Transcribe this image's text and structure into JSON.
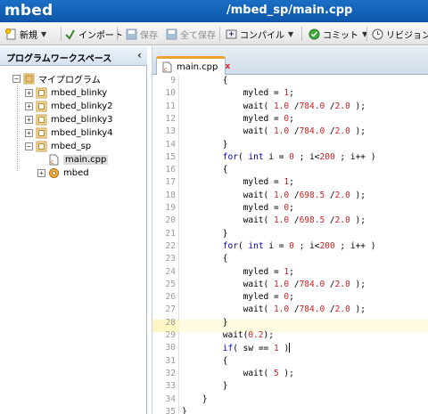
{
  "app": {
    "brand": "mbed",
    "doc_title": "/mbed_sp/main.cpp"
  },
  "toolbar": {
    "new": "新規",
    "import": "インポート",
    "save": "保存",
    "save_all": "全て保存",
    "compile": "コンパイル",
    "commit": "コミット",
    "revision": "リビジョン"
  },
  "sidebar": {
    "title": "プログラムワークスペース",
    "root": "マイプログラム",
    "items": [
      {
        "label": "mbed_blinky"
      },
      {
        "label": "mbed_blinky2"
      },
      {
        "label": "mbed_blinky3"
      },
      {
        "label": "mbed_blinky4"
      },
      {
        "label": "mbed_sp"
      },
      {
        "label": "main.cpp"
      },
      {
        "label": "mbed"
      }
    ]
  },
  "editor": {
    "tab_label": "main.cpp",
    "tab_close": "x",
    "current_line": 30,
    "lines": [
      {
        "n": "9",
        "code": "        {"
      },
      {
        "n": "10",
        "code": "            myled = 1;"
      },
      {
        "n": "11",
        "code": "            wait( 1.0 /784.0 /2.0 );"
      },
      {
        "n": "12",
        "code": "            myled = 0;"
      },
      {
        "n": "13",
        "code": "            wait( 1.0 /784.0 /2.0 );"
      },
      {
        "n": "14",
        "code": "        }"
      },
      {
        "n": "15",
        "code": "        for( int i = 0 ; i<200 ; i++ )"
      },
      {
        "n": "16",
        "code": "        {"
      },
      {
        "n": "17",
        "code": "            myled = 1;"
      },
      {
        "n": "18",
        "code": "            wait( 1.0 /698.5 /2.0 );"
      },
      {
        "n": "19",
        "code": "            myled = 0;"
      },
      {
        "n": "20",
        "code": "            wait( 1.0 /698.5 /2.0 );"
      },
      {
        "n": "21",
        "code": "        }"
      },
      {
        "n": "22",
        "code": "        for( int i = 0 ; i<200 ; i++ )"
      },
      {
        "n": "23",
        "code": "        {"
      },
      {
        "n": "24",
        "code": "            myled = 1;"
      },
      {
        "n": "25",
        "code": "            wait( 1.0 /784.0 /2.0 );"
      },
      {
        "n": "26",
        "code": "            myled = 0;"
      },
      {
        "n": "27",
        "code": "            wait( 1.0 /784.0 /2.0 );"
      },
      {
        "n": "28",
        "code": "        }"
      },
      {
        "n": "29",
        "code": "        wait(0.2);"
      },
      {
        "n": "30",
        "code": "        if( sw == 1 )"
      },
      {
        "n": "31",
        "code": "        {"
      },
      {
        "n": "32",
        "code": "            wait( 5 );"
      },
      {
        "n": "33",
        "code": "        }"
      },
      {
        "n": "34",
        "code": "    }"
      },
      {
        "n": "35",
        "code": "}"
      },
      {
        "n": "36",
        "code": ""
      }
    ]
  },
  "colors": {
    "title_bar": "#0c56a8",
    "keyword": "#0000c8",
    "number": "#d02020",
    "tab_accent": "#f0a030"
  }
}
